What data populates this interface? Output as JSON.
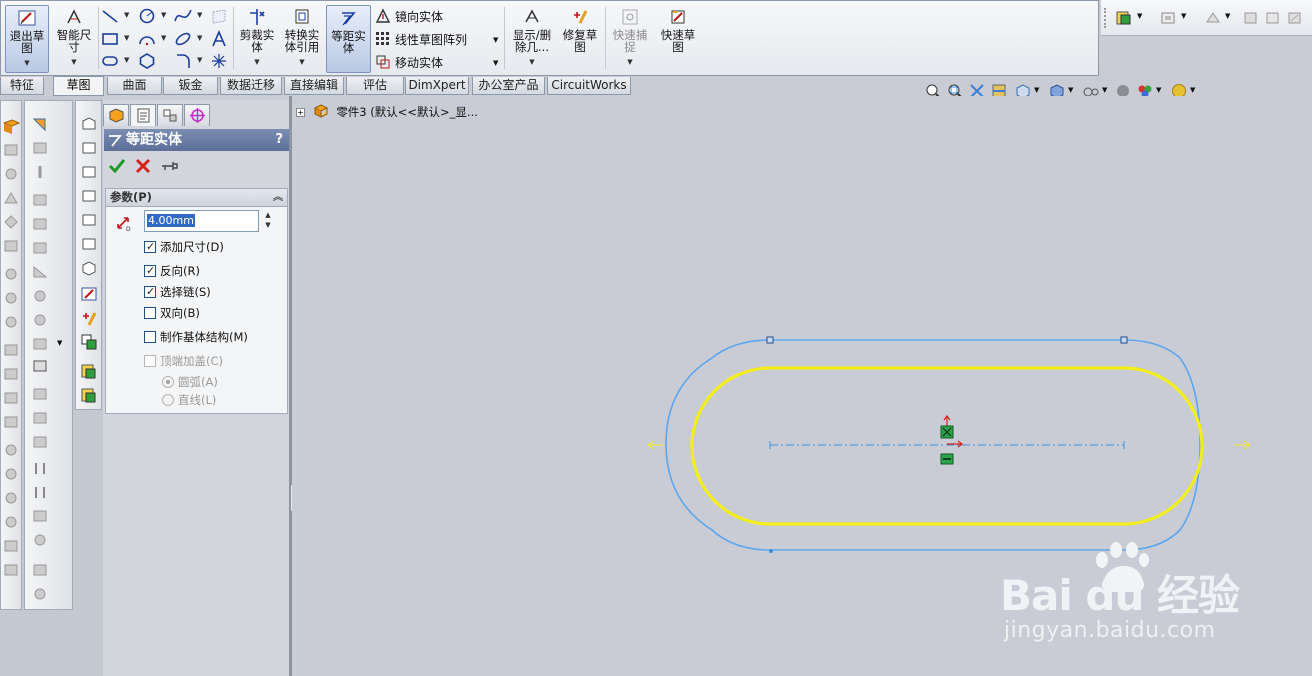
{
  "ribbon": {
    "exit_sketch": "退出草图",
    "smart_dimension": "智能尺寸",
    "trim": "剪裁实体",
    "convert": "转换实体引用",
    "offset": "等距实体",
    "mirror": "镜向实体",
    "linear_pattern": "线性草图阵列",
    "move": "移动实体",
    "show_delete": "显示/删除几...",
    "repair": "修复草图",
    "quick_snaps": "快速捕捉",
    "rapid_sketch": "快速草图"
  },
  "tabs": [
    "特征",
    "草图",
    "曲面",
    "钣金",
    "数据迁移",
    "直接编辑",
    "评估",
    "DimXpert",
    "办公室产品",
    "CircuitWorks"
  ],
  "active_tab": "草图",
  "property_manager": {
    "title": "等距实体",
    "help": "?",
    "group_title": "参数(P)",
    "distance": "4.00mm",
    "options": [
      {
        "label": "添加尺寸(D)",
        "checked": true,
        "disabled": false
      },
      {
        "label": "反向(R)",
        "checked": true,
        "disabled": false
      },
      {
        "label": "选择链(S)",
        "checked": true,
        "disabled": false
      },
      {
        "label": "双向(B)",
        "checked": false,
        "disabled": false
      },
      {
        "label": "制作基体结构(M)",
        "checked": false,
        "disabled": false
      },
      {
        "label": "顶端加盖(C)",
        "checked": false,
        "disabled": true
      }
    ],
    "cap_options": [
      {
        "label": "圆弧(A)",
        "selected": true
      },
      {
        "label": "直线(L)",
        "selected": false
      }
    ]
  },
  "feature_tree": {
    "item": "零件3 (默认<<默认>_显..."
  },
  "colors": {
    "offset_outline": "#5da6ee",
    "original_sketch": "#f2ee1c",
    "centerline": "#3b8fdc",
    "title_bar": "#6a7ea8"
  },
  "watermark": {
    "logo": "Bai du 经验",
    "url": "jingyan.baidu.com"
  }
}
